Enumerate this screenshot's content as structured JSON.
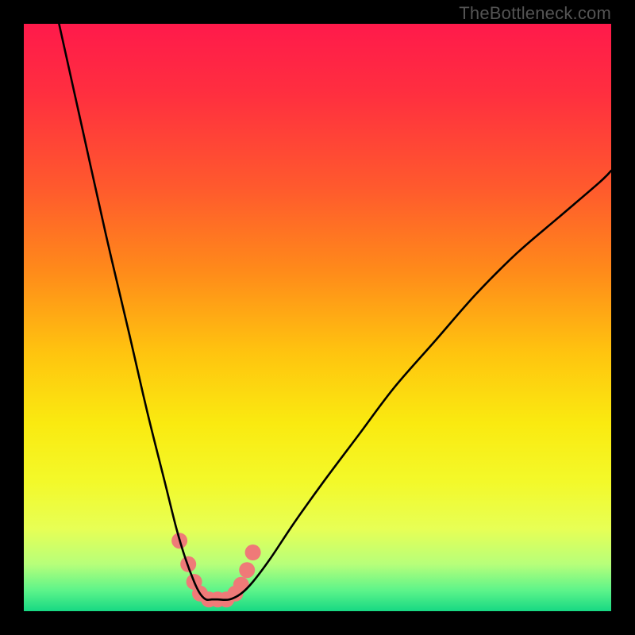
{
  "watermark": "TheBottleneck.com",
  "gradient_stops": [
    {
      "offset": 0.0,
      "color": "#ff1a4b"
    },
    {
      "offset": 0.12,
      "color": "#ff2f3f"
    },
    {
      "offset": 0.28,
      "color": "#ff5a2d"
    },
    {
      "offset": 0.42,
      "color": "#ff8a1a"
    },
    {
      "offset": 0.56,
      "color": "#ffc40f"
    },
    {
      "offset": 0.68,
      "color": "#faea10"
    },
    {
      "offset": 0.78,
      "color": "#f3f92a"
    },
    {
      "offset": 0.86,
      "color": "#e7ff55"
    },
    {
      "offset": 0.92,
      "color": "#b7ff7a"
    },
    {
      "offset": 0.965,
      "color": "#5cf48a"
    },
    {
      "offset": 1.0,
      "color": "#17d883"
    }
  ],
  "chart_data": {
    "type": "line",
    "title": "",
    "xlabel": "",
    "ylabel": "",
    "xlim": [
      0,
      100
    ],
    "ylim": [
      0,
      100
    ],
    "series": [
      {
        "name": "curve",
        "x": [
          6,
          10,
          14,
          18,
          21,
          24,
          26,
          27.5,
          29,
          30,
          31,
          32,
          33,
          35,
          37,
          39,
          42,
          46,
          51,
          57,
          63,
          70,
          77,
          84,
          91,
          98,
          100
        ],
        "y": [
          100,
          82,
          64,
          47,
          34,
          22,
          14,
          9,
          5,
          3,
          2,
          2,
          2,
          2,
          3,
          5,
          9,
          15,
          22,
          30,
          38,
          46,
          54,
          61,
          67,
          73,
          75
        ]
      }
    ],
    "markers": [
      {
        "x": 26.5,
        "y": 12
      },
      {
        "x": 28.0,
        "y": 8
      },
      {
        "x": 29.0,
        "y": 5
      },
      {
        "x": 30.0,
        "y": 3
      },
      {
        "x": 31.5,
        "y": 2
      },
      {
        "x": 33.0,
        "y": 2
      },
      {
        "x": 34.5,
        "y": 2
      },
      {
        "x": 36.0,
        "y": 3
      },
      {
        "x": 37.0,
        "y": 4.5
      },
      {
        "x": 38.0,
        "y": 7
      },
      {
        "x": 39.0,
        "y": 10
      }
    ],
    "marker_style": {
      "fill": "#ef7a78",
      "r": 10
    },
    "curve_style": {
      "stroke": "#000000",
      "width": 2.6
    }
  }
}
